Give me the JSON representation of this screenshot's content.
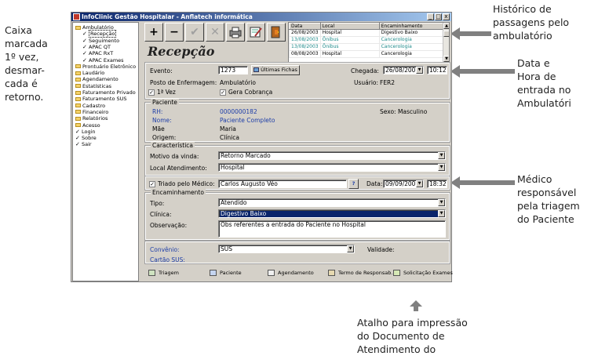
{
  "window": {
    "title": "InfoClinic Gestão Hospitalar - Anflatech informática",
    "controls": [
      "_",
      "□",
      "x"
    ]
  },
  "tree": [
    {
      "label": "Ambulatório",
      "type": "folder",
      "level": 0
    },
    {
      "label": "Recepção",
      "type": "check",
      "level": 1,
      "selected": true
    },
    {
      "label": "Seguimento",
      "type": "check",
      "level": 1
    },
    {
      "label": "APAC QT",
      "type": "check",
      "level": 1
    },
    {
      "label": "APAC RxT",
      "type": "check",
      "level": 1
    },
    {
      "label": "APAC Exames",
      "type": "check",
      "level": 1
    },
    {
      "label": "Prontuário Eletrônico",
      "type": "folder",
      "level": 0
    },
    {
      "label": "Laudário",
      "type": "folder",
      "level": 0
    },
    {
      "label": "Agendamento",
      "type": "folder",
      "level": 0
    },
    {
      "label": "Estatísticas",
      "type": "folder",
      "level": 0
    },
    {
      "label": "Faturamento Privado",
      "type": "folder",
      "level": 0
    },
    {
      "label": "Faturamento SUS",
      "type": "folder",
      "level": 0
    },
    {
      "label": "Cadastro",
      "type": "folder",
      "level": 0
    },
    {
      "label": "Financeiro",
      "type": "folder",
      "level": 0
    },
    {
      "label": "Relatórios",
      "type": "folder",
      "level": 0
    },
    {
      "label": "Acesso",
      "type": "folder",
      "level": 0
    },
    {
      "label": "Login",
      "type": "check",
      "level": 0
    },
    {
      "label": "Sobre",
      "type": "check",
      "level": 0
    },
    {
      "label": "Sair",
      "type": "check",
      "level": 0
    }
  ],
  "toolbar": {
    "add": "+",
    "remove": "−",
    "confirm": "✔",
    "cancel": "✕"
  },
  "page_title": "Recepção",
  "history": {
    "headers": [
      "Data",
      "Local",
      "Encaminhamento"
    ],
    "rows": [
      {
        "data": "26/08/2003",
        "local": "Hospital",
        "encaminhamento": "Digestivo Baixo",
        "color": "#000000"
      },
      {
        "data": "13/08/2003",
        "local": "Ônibus",
        "encaminhamento": "Cancerologia",
        "color": "#1e8a8a"
      },
      {
        "data": "13/08/2003",
        "local": "Ônibus",
        "encaminhamento": "Cancerologia",
        "color": "#1e8a8a"
      },
      {
        "data": "08/08/2003",
        "local": "Hospital",
        "encaminhamento": "Cancerologia",
        "color": "#000000"
      }
    ]
  },
  "evento": {
    "label": "Evento:",
    "value": "1273",
    "ultimas_fichas": "Últimas Fichas",
    "chegada_label": "Chegada:",
    "chegada_date": "26/08/2003",
    "chegada_time": "10:12",
    "posto_label": "Posto de Enfermagem:",
    "posto_value": "Ambulatório",
    "usuario_label": "Usuário:",
    "usuario_value": "FER2",
    "primeira_vez": "1ª Vez",
    "gera_cobranca": "Gera Cobrança"
  },
  "paciente": {
    "group": "Paciente",
    "rh_label": "RH:",
    "rh_value": "0000000182",
    "sexo": "Sexo: Masculino",
    "nome_label": "Nome:",
    "nome_value": "Paciente Completo",
    "mae_label": "Mãe",
    "mae_value": "Maria",
    "origem_label": "Origem:",
    "origem_value": "Clínica"
  },
  "caracteristica": {
    "group": "Característica",
    "motivo_label": "Motivo da vinda:",
    "motivo_value": "Retorno Marcado",
    "local_label": "Local Atendimento:",
    "local_value": "Hospital"
  },
  "triagem": {
    "label": "Triado pelo Médico:",
    "medico": "Carlos Augusto Véo",
    "help": "?",
    "data_label": "Data:",
    "data_value": "09/09/2003",
    "hora_value": "18:32"
  },
  "encaminhamento": {
    "group": "Encaminhamento",
    "tipo_label": "Tipo:",
    "tipo_value": "Atendido",
    "clinica_label": "Clínica:",
    "clinica_value": "Digestivo Baixo",
    "obs_label": "Observação:",
    "obs_value": "Obs referentes a entrada do Paciente no Hospital"
  },
  "convenio": {
    "label": "Convênio:",
    "value": "SUS",
    "validade_label": "Validade:",
    "cartao_label": "Cartão SUS:"
  },
  "footer": [
    "Triagem",
    "Paciente",
    "Agendamento",
    "Termo de Responsab.",
    "Solicitação Exames"
  ],
  "annotations": {
    "left": "Caixa\nmarcada\n1º vez,\ndesmar-\ncada é\nretorno.",
    "history": "Histórico de\npassagens pelo\nambulatório",
    "arrival": "Data e\nHora de\nentrada no\nAmbulatóri",
    "doctor": "Médico\nresponsável\npela triagem\ndo Paciente",
    "print": "Atalho para impressão\ndo Documento de\nAtendimento do"
  }
}
